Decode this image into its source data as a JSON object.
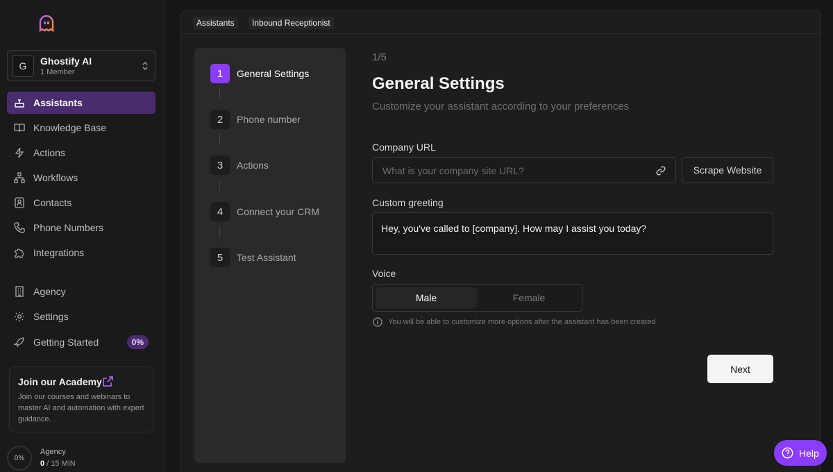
{
  "workspace": {
    "initial": "G",
    "name": "Ghostify AI",
    "members": "1 Member"
  },
  "sidebar": {
    "items": [
      {
        "label": "Assistants",
        "icon": "assistant-icon"
      },
      {
        "label": "Knowledge Base",
        "icon": "book-icon"
      },
      {
        "label": "Actions",
        "icon": "lightning-icon"
      },
      {
        "label": "Workflows",
        "icon": "workflow-icon"
      },
      {
        "label": "Contacts",
        "icon": "contact-card-icon"
      },
      {
        "label": "Phone Numbers",
        "icon": "phone-icon"
      },
      {
        "label": "Integrations",
        "icon": "puzzle-icon"
      },
      {
        "label": "Agency",
        "icon": "building-icon"
      },
      {
        "label": "Settings",
        "icon": "gear-icon"
      },
      {
        "label": "Getting Started",
        "icon": "rocket-icon",
        "badge": "0%"
      }
    ]
  },
  "academy": {
    "title": "Join our Academy",
    "body": "Join our courses and webinars to master AI and automation with expert guidance."
  },
  "usage": {
    "percent_label": "0%",
    "plan": "Agency",
    "used": "0",
    "total": "/ 15 MIN"
  },
  "breadcrumb": [
    "Assistants",
    "Inbound Receptionist"
  ],
  "steps": [
    {
      "num": "1",
      "label": "General Settings"
    },
    {
      "num": "2",
      "label": "Phone number"
    },
    {
      "num": "3",
      "label": "Actions"
    },
    {
      "num": "4",
      "label": "Connect your CRM"
    },
    {
      "num": "5",
      "label": "Test Assistant"
    }
  ],
  "form": {
    "counter": "1/5",
    "title": "General Settings",
    "subtitle": "Customize your assistant according to your preferences",
    "company_url_label": "Company URL",
    "company_url_placeholder": "What is your company site URL?",
    "scrape_label": "Scrape Website",
    "greeting_label": "Custom greeting",
    "greeting_value": "Hey, you've called to [company]. How may I assist you today?",
    "voice_label": "Voice",
    "voice_options": [
      "Male",
      "Female"
    ],
    "voice_selected": "Male",
    "voice_note": "You will be able to customize more options after the assistant has been created",
    "next_label": "Next"
  },
  "help": {
    "label": "Help"
  },
  "colors": {
    "accent": "#8b3dff",
    "active_nav": "#4a2d6e"
  }
}
